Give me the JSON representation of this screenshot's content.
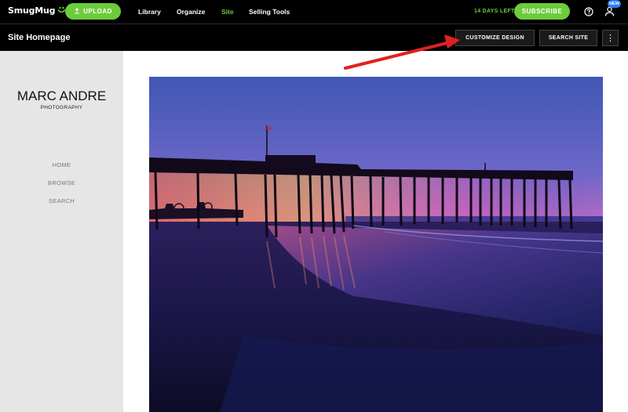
{
  "topbar": {
    "brand": "SmugMug",
    "upload_label": "UPLOAD",
    "nav": [
      "Library",
      "Organize",
      "Site",
      "Selling Tools"
    ],
    "active_nav": "Site",
    "trial_text": "14 DAYS LEFT",
    "subscribe_label": "SUBSCRIBE",
    "new_badge": "NEW"
  },
  "subbar": {
    "title": "Site Homepage",
    "customize_label": "CUSTOMIZE DESIGN",
    "search_label": "SEARCH SITE",
    "more_label": "⋮"
  },
  "sidebar": {
    "site_name": "MARC ANDRE",
    "site_subtitle": "PHOTOGRAPHY",
    "links": [
      "HOME",
      "BROWSE",
      "SEARCH"
    ]
  },
  "colors": {
    "brand_green": "#6ccc3b",
    "annotation_red": "#e02020",
    "badge_blue": "#2d7cf6"
  },
  "icons": {
    "logo": "smugmug-face-icon",
    "upload": "upload-icon",
    "help": "help-circle-icon",
    "user": "user-icon",
    "more": "vertical-dots-icon"
  }
}
